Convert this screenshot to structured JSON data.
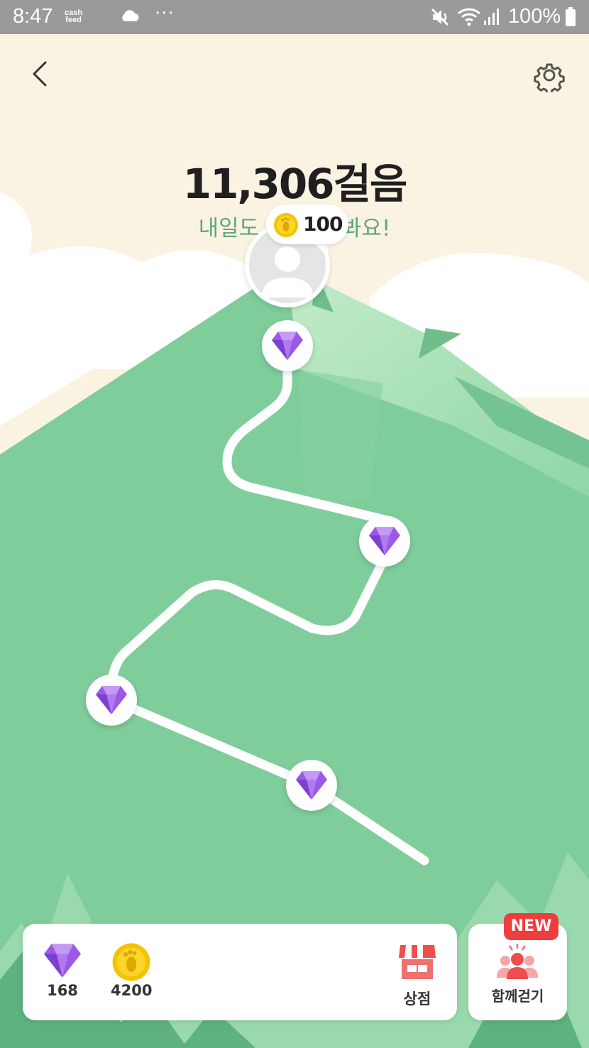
{
  "status_bar": {
    "time": "8:47",
    "notif_app_line1": "cash",
    "notif_app_line2": "feed",
    "more_dots": "···",
    "battery_text": "100%"
  },
  "header": {
    "back_icon": "chevron-left-icon",
    "settings_icon": "gear-icon"
  },
  "summary": {
    "steps_text": "11,306걸음",
    "subtitle_left": "내일도 ",
    "subtitle_right": " 봐요!"
  },
  "reward_bubble": {
    "amount": "100",
    "icon": "footprint-coin-icon"
  },
  "path_nodes": [
    {
      "icon": "diamond-icon"
    },
    {
      "icon": "diamond-icon"
    },
    {
      "icon": "diamond-icon"
    },
    {
      "icon": "diamond-icon"
    }
  ],
  "bottom_bar": {
    "gems": "168",
    "coins": "4200",
    "shop_label": "상점",
    "walk_together_label": "함께걷기",
    "new_badge": "NEW"
  },
  "colors": {
    "sky": "#fbf3e2",
    "mountain": "#7fcd9b",
    "gem": "#9b59e6",
    "coin": "#f6c200",
    "new_badge": "#ee3d3d",
    "subtitle": "#5fa77a"
  }
}
